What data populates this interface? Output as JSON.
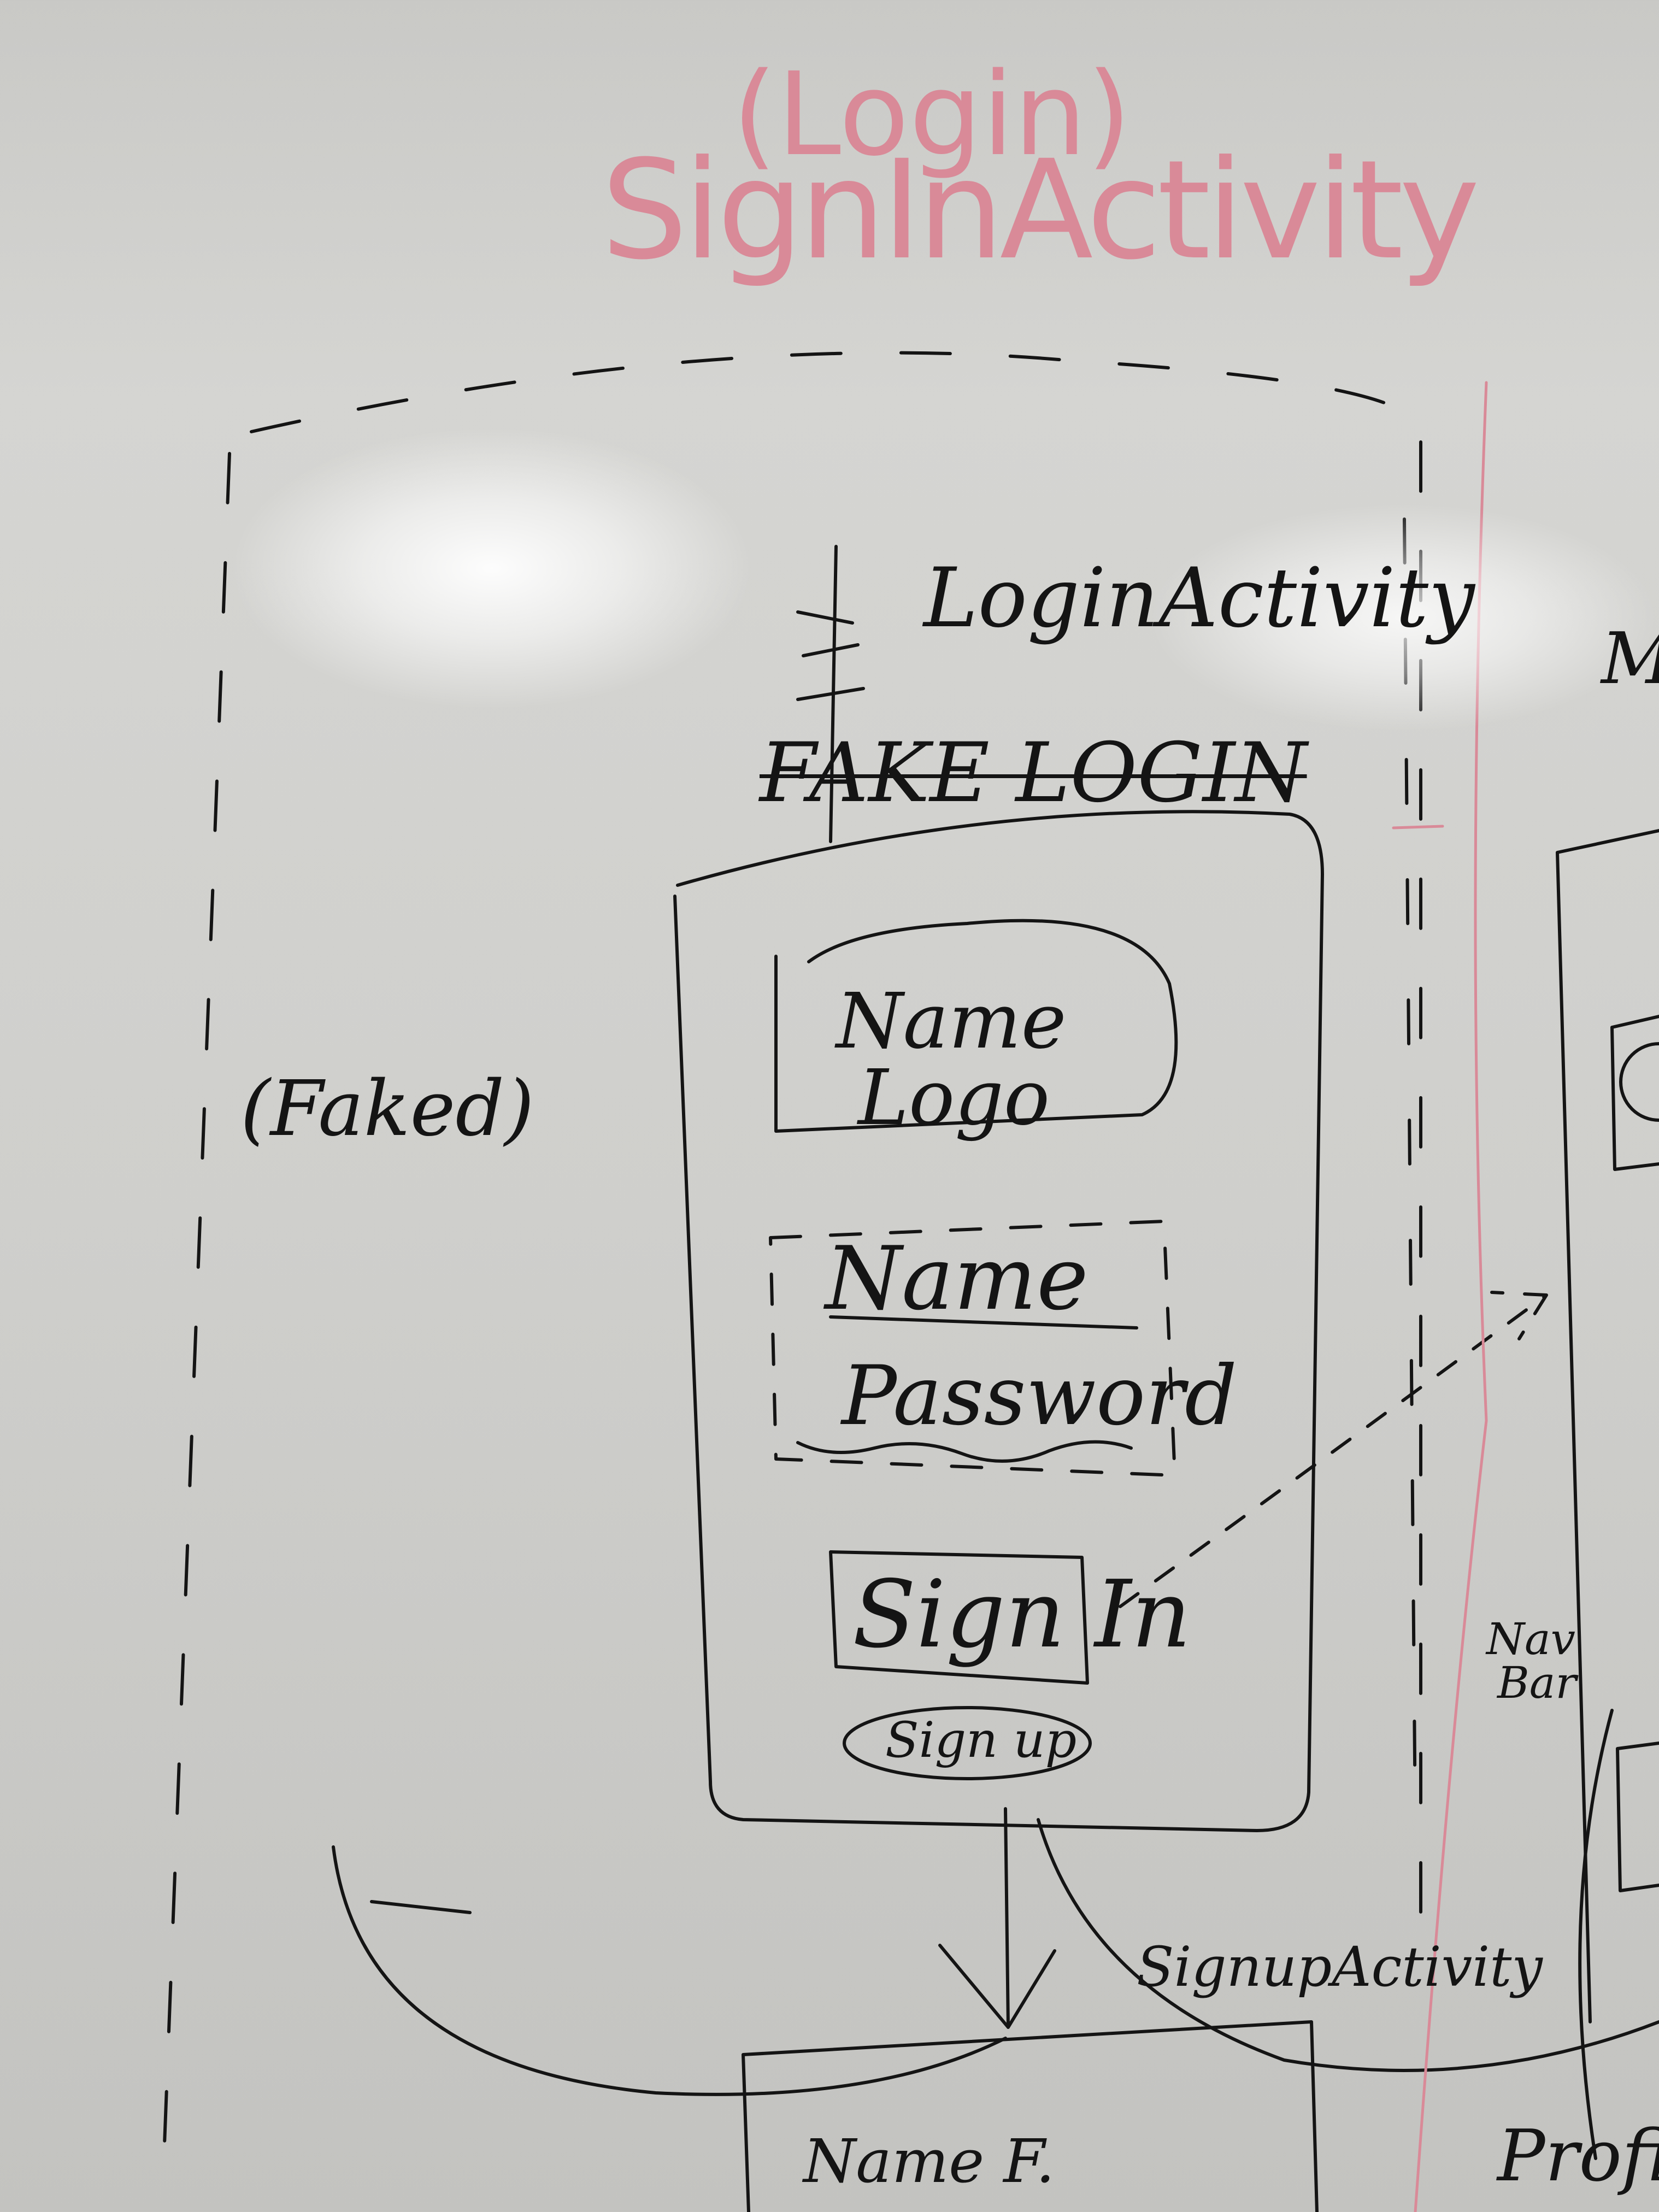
{
  "heading": {
    "parenthetical": "(Login)",
    "title": "SignInActivity"
  },
  "labels": {
    "login_activity": "LoginActivity",
    "fake_login": "FAKE LOGIN",
    "faked_note": "(Faked)",
    "name_logo_line1": "Name",
    "name_logo_line2": "Logo",
    "name_field": "Name",
    "password_field": "Password",
    "sign_in_button": "Sign In",
    "sign_up_button": "Sign up",
    "signup_activity": "SignupActivity",
    "nav_bar_line1": "Nav",
    "nav_bar_line2": "Bar",
    "name_f": "Name F.",
    "profile": "Profile",
    "edge_m": "M"
  },
  "colors": {
    "ink_black": "#141414",
    "ink_red": "#d98a98",
    "board": "#cfcfcc"
  }
}
